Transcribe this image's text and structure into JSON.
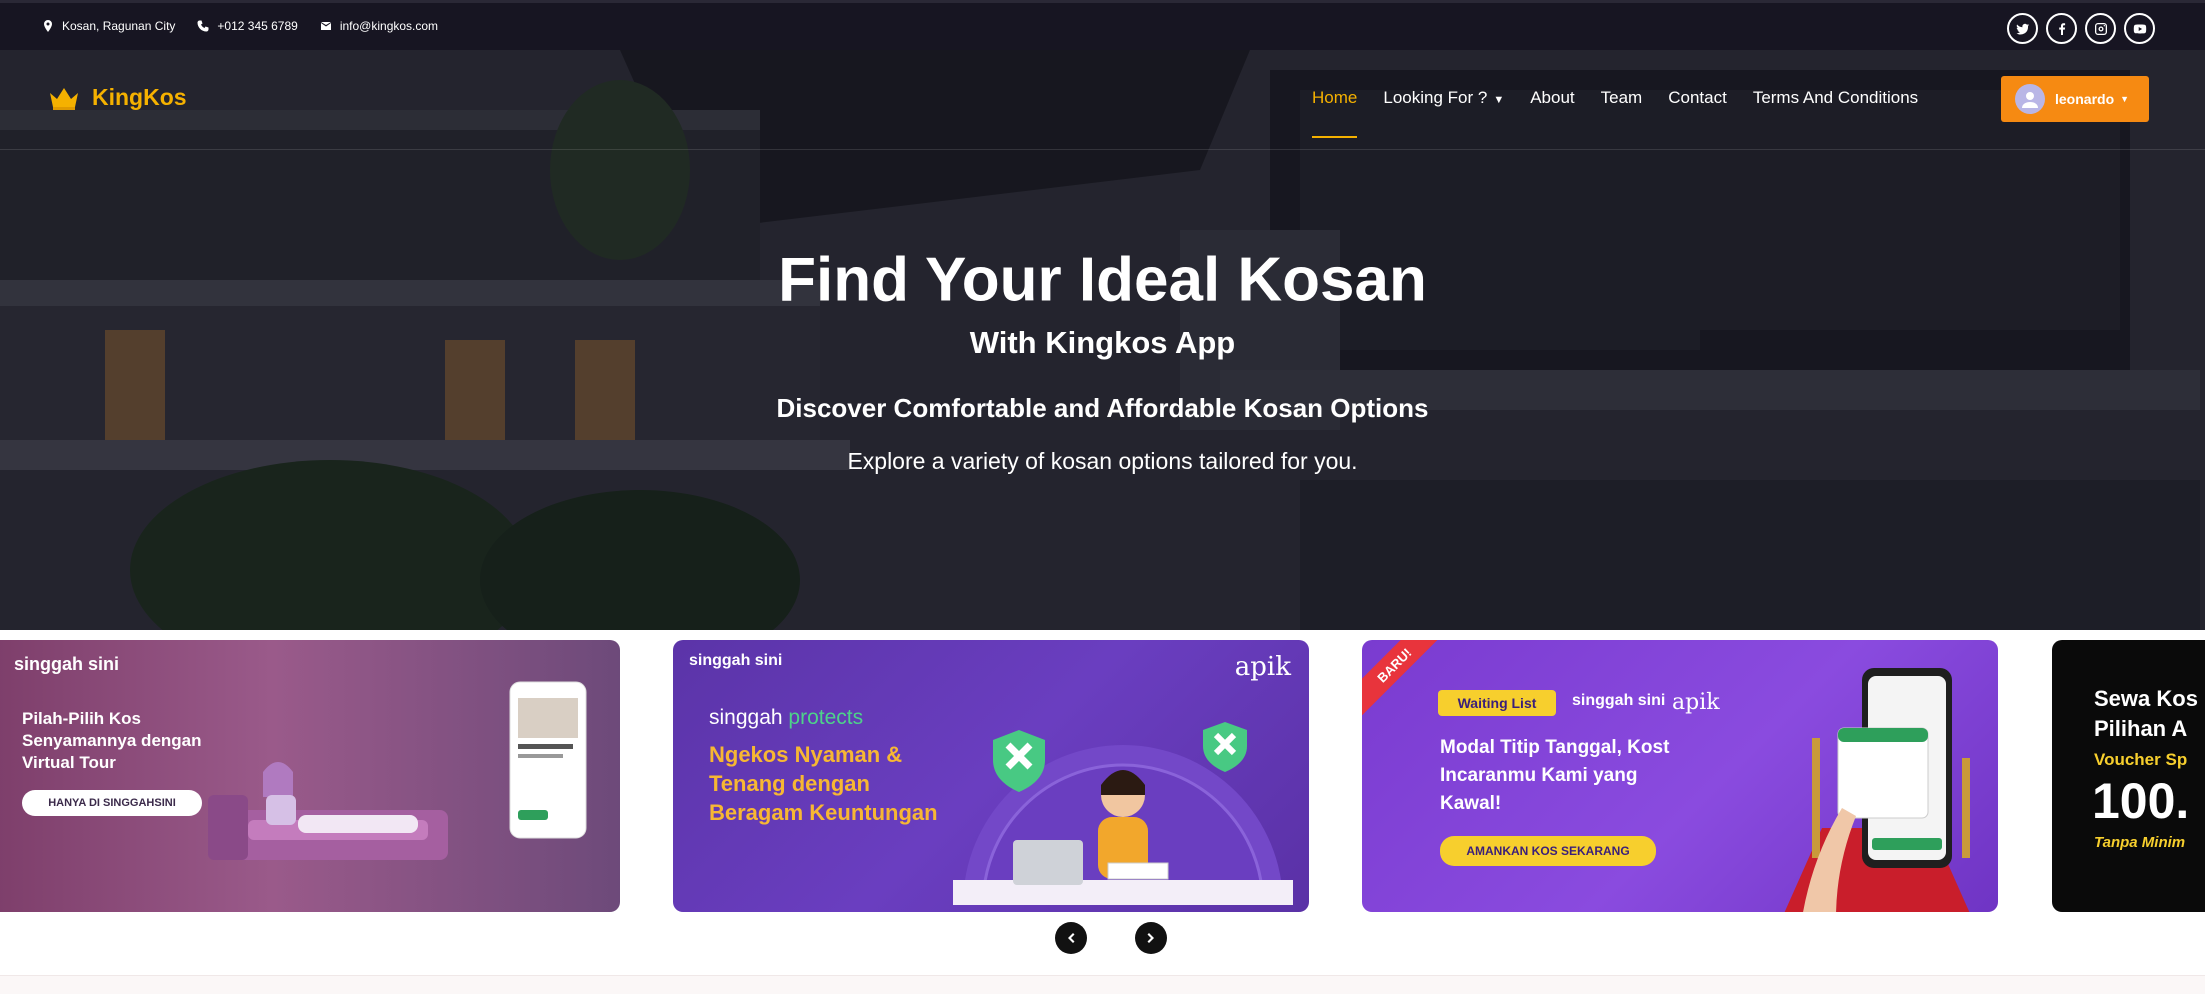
{
  "topbar": {
    "address": "Kosan, Ragunan City",
    "phone": "+012 345 6789",
    "email": "info@kingkos.com",
    "socials": [
      "twitter-icon",
      "facebook-icon",
      "instagram-icon",
      "youtube-icon"
    ]
  },
  "nav": {
    "brand": "KingKos",
    "items": [
      {
        "label": "Home",
        "active": true
      },
      {
        "label": "Looking For ?",
        "dropdown": true
      },
      {
        "label": "About"
      },
      {
        "label": "Team"
      },
      {
        "label": "Contact"
      },
      {
        "label": "Terms And Conditions"
      }
    ],
    "user": "leonardo"
  },
  "hero": {
    "title": "Find Your Ideal Kosan",
    "subtitle": "With Kingkos App",
    "tagline": "Discover Comfortable and Affordable Kosan Options",
    "description": "Explore a variety of kosan options tailored for you."
  },
  "banners": [
    {
      "brand": "singgah sini",
      "headline": "Pilah-Pilih Kos Senyamannya dengan Virtual Tour",
      "button": "HANYA DI SINGGAHSINI"
    },
    {
      "brand": "singgah sini",
      "partner": "apik",
      "kicker_a": "singgah",
      "kicker_b": "protects",
      "headline": "Ngekos Nyaman & Tenang dengan Beragam Keuntungan"
    },
    {
      "ribbon": "BARU!",
      "tag": "Waiting List",
      "brand": "singgah sini",
      "partner": "apik",
      "headline": "Modal Titip Tanggal, Kost Incaranmu Kami yang Kawal!",
      "button": "AMANKAN KOS SEKARANG"
    },
    {
      "line1": "Sewa Kos",
      "line2": "Pilihan A",
      "line3": "Voucher Sp",
      "line4": "100.",
      "line5": "Tanpa Minim"
    }
  ],
  "colors": {
    "accent": "#f5b100",
    "user_button": "#f68a12",
    "topbar": "#171522"
  }
}
